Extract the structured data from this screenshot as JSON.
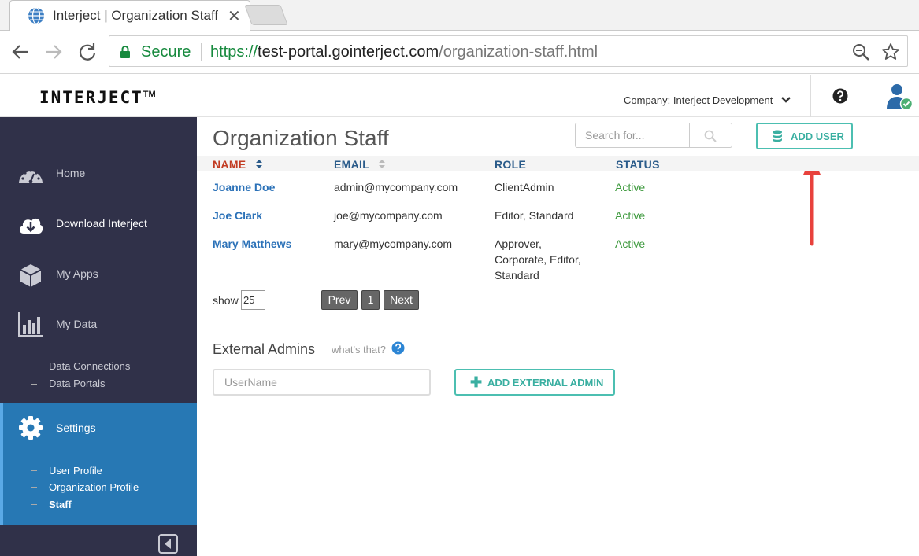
{
  "browser": {
    "tab_title": "Interject | Organization Staff",
    "secure_label": "Secure",
    "url_protocol": "https://",
    "url_host": "test-portal.gointerject.com",
    "url_path": "/organization-staff.html"
  },
  "header": {
    "logo": "INTERJECT",
    "logo_tm": "TM",
    "company_label": "Company: Interject Development"
  },
  "sidebar": {
    "items": [
      {
        "label": "Home",
        "icon": "dashboard-icon"
      },
      {
        "label": "Download Interject",
        "icon": "cloud-download-icon"
      },
      {
        "label": "My Apps",
        "icon": "cube-icon"
      },
      {
        "label": "My Data",
        "icon": "bar-chart-icon"
      }
    ],
    "data_subitems": [
      "Data Connections",
      "Data Portals"
    ],
    "settings_label": "Settings",
    "settings_subitems": [
      "User Profile",
      "Organization Profile",
      "Staff"
    ]
  },
  "main": {
    "title": "Organization Staff",
    "search_placeholder": "Search for...",
    "add_user_label": "ADD USER",
    "columns": [
      "NAME",
      "EMAIL",
      "ROLE",
      "STATUS"
    ],
    "rows": [
      {
        "name": "Joanne Doe",
        "email": "admin@mycompany.com",
        "role_lines": [
          "ClientAdmin"
        ],
        "status": "Active"
      },
      {
        "name": "Joe Clark",
        "email": "joe@mycompany.com",
        "role_lines": [
          "Editor, Standard"
        ],
        "status": "Active"
      },
      {
        "name": "Mary Matthews",
        "email": "mary@mycompany.com",
        "role_lines": [
          "Approver,",
          "Corporate, Editor,",
          "Standard"
        ],
        "status": "Active"
      }
    ],
    "show_label": "show",
    "show_value": "25",
    "pagination": {
      "prev": "Prev",
      "page": "1",
      "next": "Next"
    },
    "external_admins_title": "External Admins",
    "whats_that": "what's that?",
    "username_placeholder": "UserName",
    "add_external_label": "ADD EXTERNAL ADMIN"
  },
  "colors": {
    "sidebar_bg": "#303149",
    "settings_active": "#2778b4",
    "accent_teal": "#4cbfb1",
    "link_blue": "#2c72b8",
    "status_green": "#3e9a3e",
    "annotation_red": "#e8413c"
  }
}
